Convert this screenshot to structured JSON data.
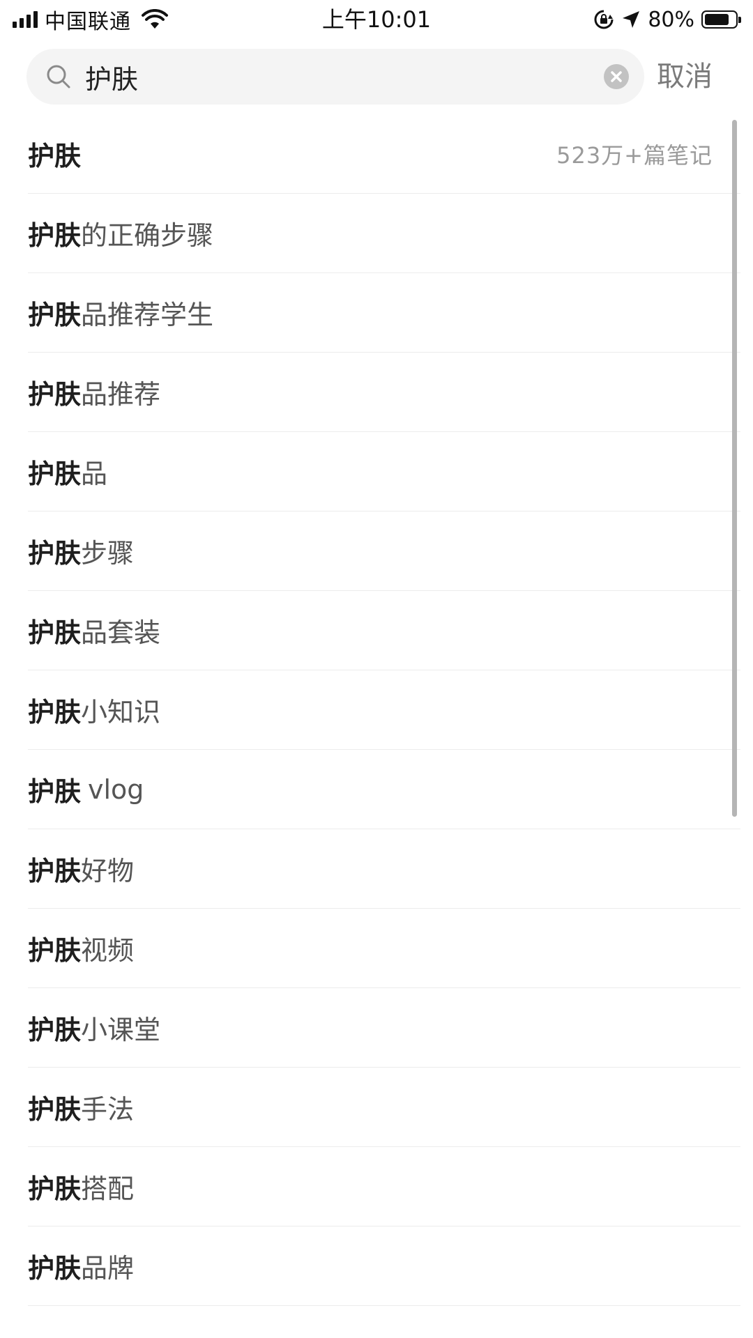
{
  "status_bar": {
    "carrier": "中国联通",
    "time": "上午10:01",
    "battery_percent_text": "80%",
    "battery_level": 0.8,
    "signal_bars": 4,
    "icons": [
      "signal-icon",
      "wifi-icon",
      "orientation-lock-icon",
      "location-arrow-icon",
      "battery-icon"
    ]
  },
  "search": {
    "query": "护肤",
    "cancel_label": "取消",
    "search_icon": "search-icon",
    "clear_icon": "clear-icon"
  },
  "suggestions": [
    {
      "keyword": "护肤",
      "rest": "",
      "meta": "523万+篇笔记"
    },
    {
      "keyword": "护肤",
      "rest": "的正确步骤"
    },
    {
      "keyword": "护肤",
      "rest": "品推荐学生"
    },
    {
      "keyword": "护肤",
      "rest": "品推荐"
    },
    {
      "keyword": "护肤",
      "rest": "品"
    },
    {
      "keyword": "护肤",
      "rest": "步骤"
    },
    {
      "keyword": "护肤",
      "rest": "品套装"
    },
    {
      "keyword": "护肤",
      "rest": "小知识"
    },
    {
      "keyword": "护肤",
      "rest": "vlog"
    },
    {
      "keyword": "护肤",
      "rest": "好物"
    },
    {
      "keyword": "护肤",
      "rest": "视频"
    },
    {
      "keyword": "护肤",
      "rest": "小课堂"
    },
    {
      "keyword": "护肤",
      "rest": "手法"
    },
    {
      "keyword": "护肤",
      "rest": "搭配"
    },
    {
      "keyword": "护肤",
      "rest": "品牌"
    }
  ],
  "colors": {
    "search_bg": "#f4f4f4",
    "keyword": "#1e1e1e",
    "suggestion_rest": "#555555",
    "meta": "#9a9a9a",
    "cancel": "#7a7a7a",
    "divider": "#ececec"
  }
}
